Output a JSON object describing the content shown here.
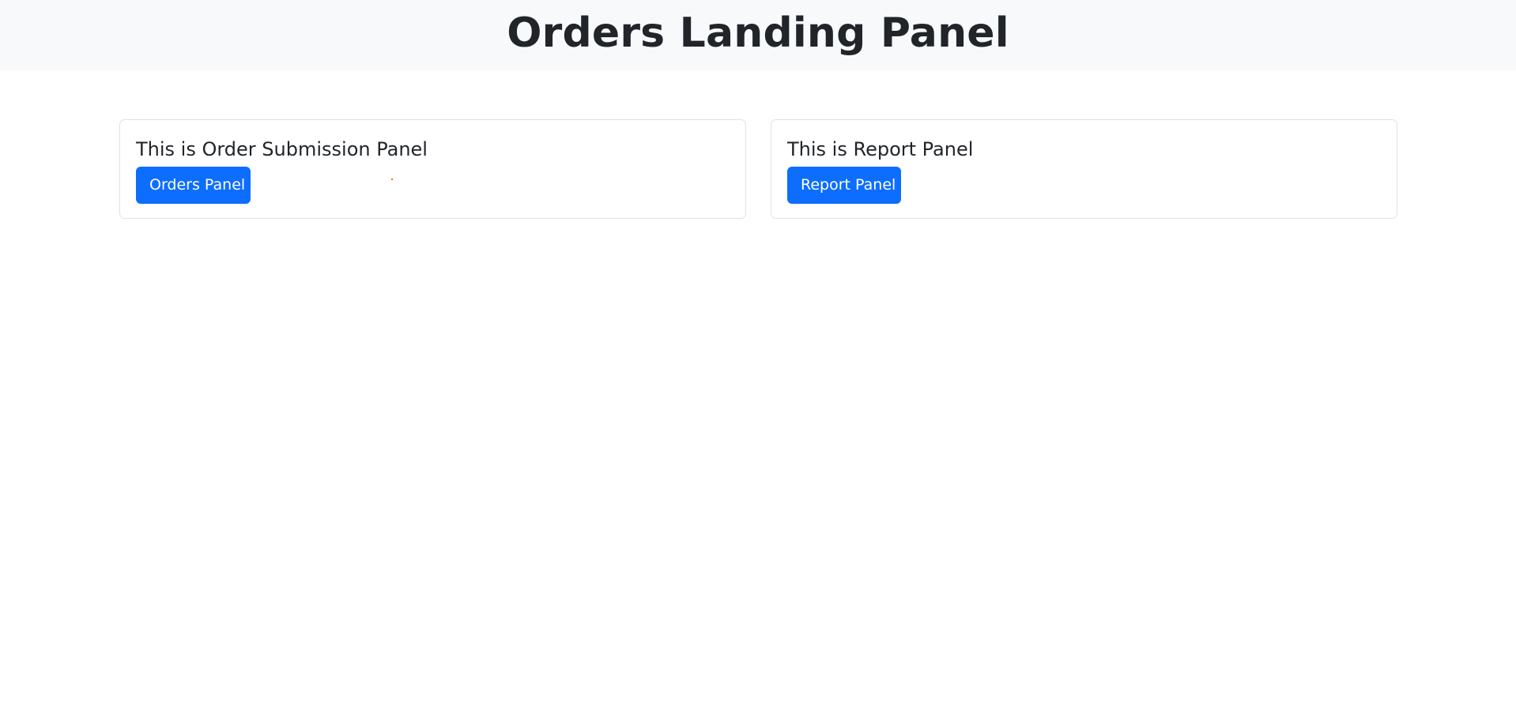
{
  "header": {
    "title": "Orders Landing Panel"
  },
  "cards": {
    "orders": {
      "title": "This is Order Submission Panel",
      "button_label": "Orders Panel"
    },
    "report": {
      "title": "This is Report Panel",
      "button_label": "Report Panel"
    }
  },
  "colors": {
    "header_background": "#f8f9fa",
    "primary_button": "#0d6efd",
    "card_border": "#dee2e6"
  }
}
